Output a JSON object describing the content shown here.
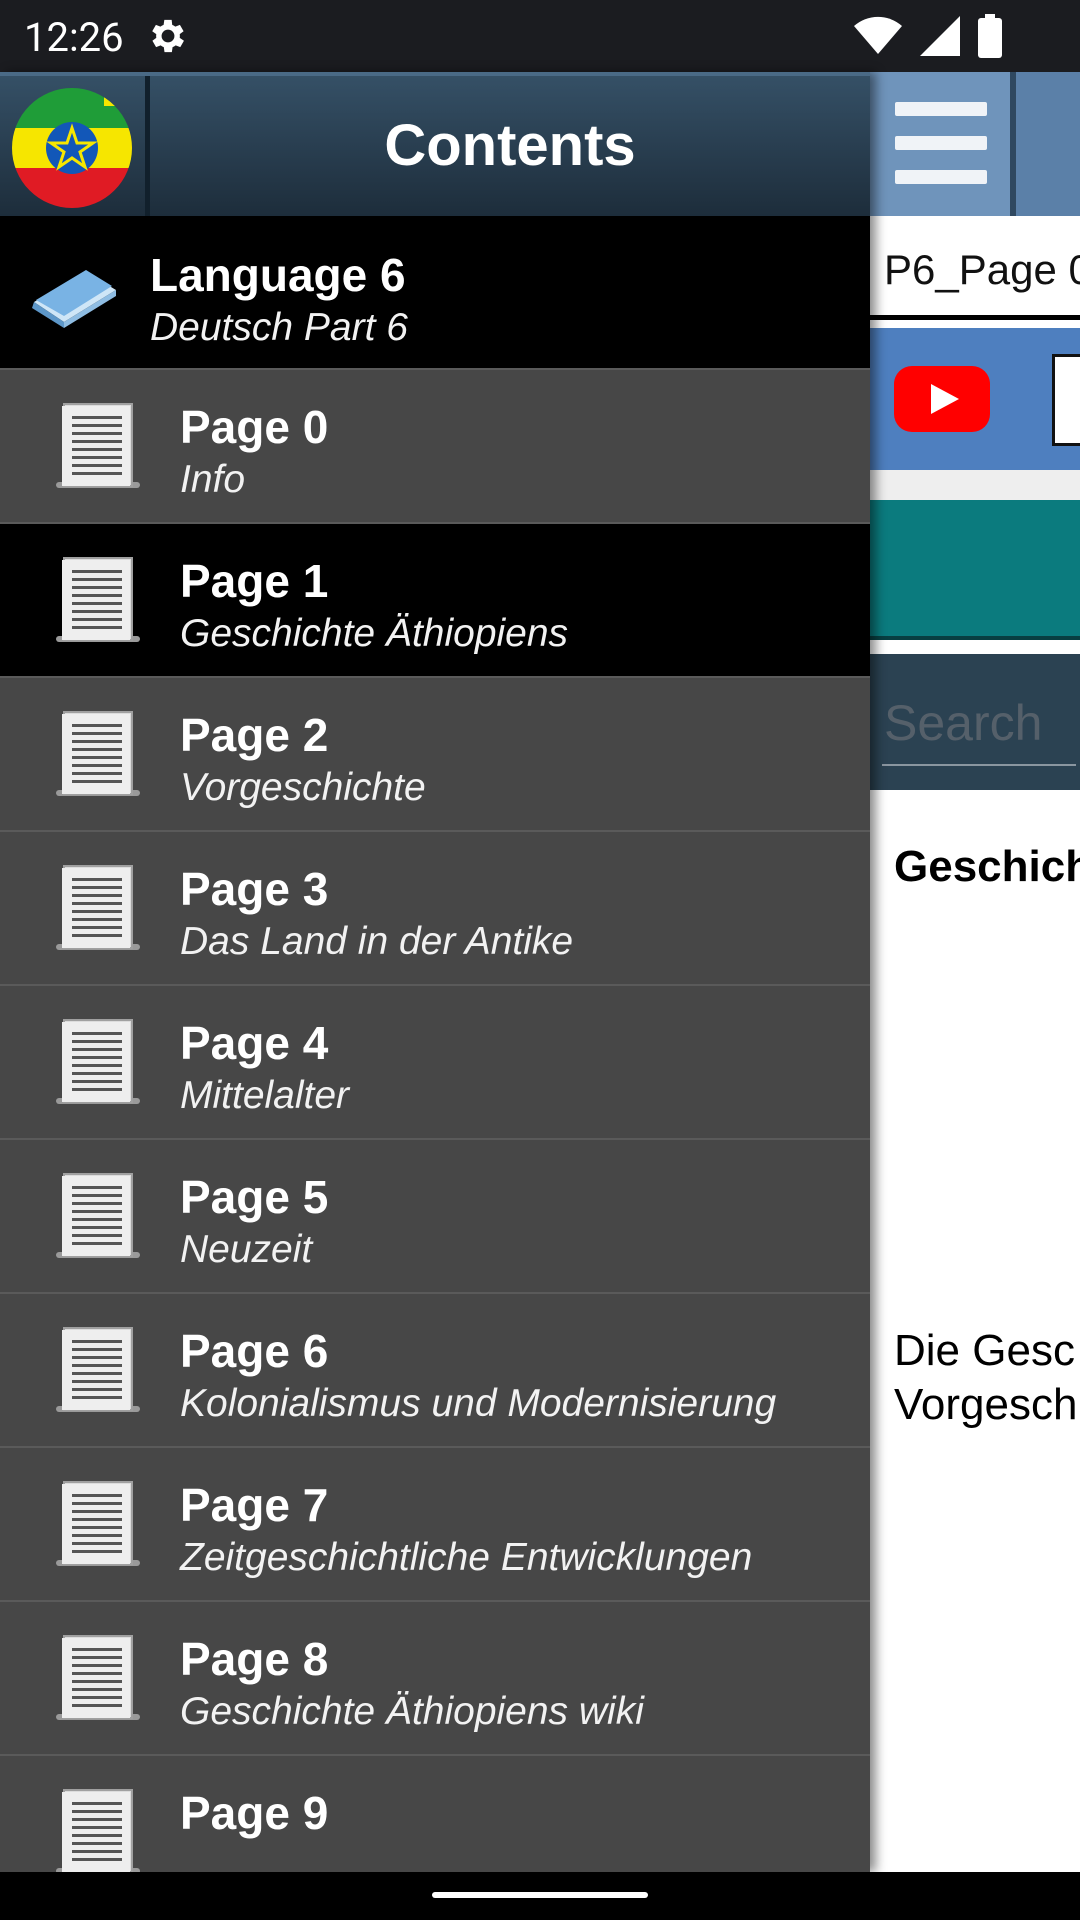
{
  "status_bar": {
    "time": "12:26",
    "icons": [
      "gear-icon",
      "wifi-icon",
      "signal-icon",
      "battery-icon"
    ]
  },
  "background_app": {
    "page_field": "P6_Page 0",
    "search_placeholder": "Search",
    "heading": "Geschich",
    "body_lines": [
      "Die Gesc",
      "Vorgesch"
    ],
    "colors": {
      "topbar": "#5b80a8",
      "teal": "#0b7b7e",
      "search_bg": "#2b4252"
    }
  },
  "drawer": {
    "title": "Contents",
    "language": {
      "title": "Language 6",
      "subtitle": "Deutsch Part 6"
    },
    "items": [
      {
        "title": "Page 0",
        "subtitle": "Info"
      },
      {
        "title": "Page 1",
        "subtitle": "Geschichte Äthiopiens",
        "active": true
      },
      {
        "title": "Page 2",
        "subtitle": "Vorgeschichte"
      },
      {
        "title": "Page 3",
        "subtitle": "Das Land in der Antike"
      },
      {
        "title": "Page 4",
        "subtitle": "Mittelalter"
      },
      {
        "title": "Page 5",
        "subtitle": "Neuzeit"
      },
      {
        "title": "Page 6",
        "subtitle": "Kolonialismus und Modernisierung"
      },
      {
        "title": "Page 7",
        "subtitle": "Zeitgeschichtliche Entwicklungen"
      },
      {
        "title": "Page 8",
        "subtitle": "Geschichte Äthiopiens wiki"
      },
      {
        "title": "Page 9",
        "subtitle": ""
      }
    ]
  }
}
